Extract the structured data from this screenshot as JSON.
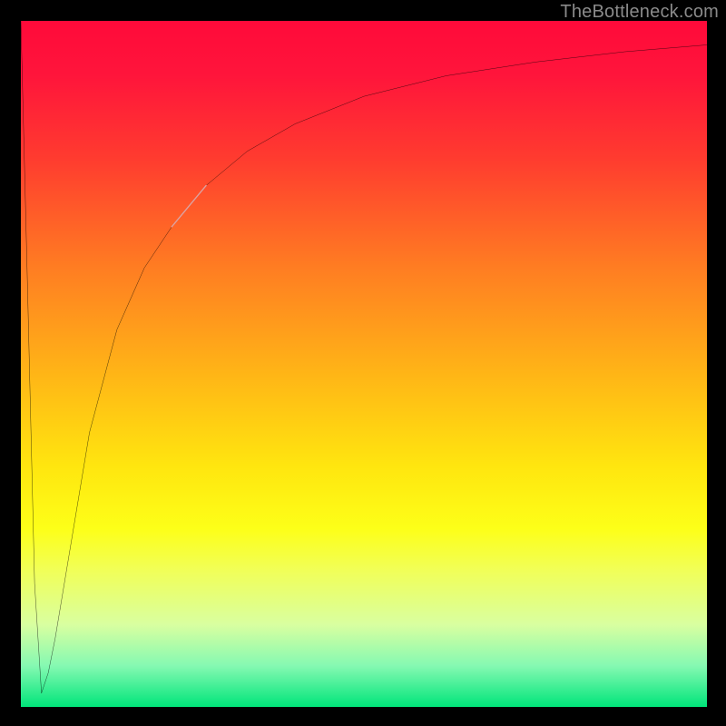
{
  "credit": "TheBottleneck.com",
  "chart_data": {
    "type": "line",
    "title": "",
    "xlabel": "",
    "ylabel": "",
    "xlim": [
      0,
      100
    ],
    "ylim": [
      0,
      100
    ],
    "grid": false,
    "series": [
      {
        "name": "curve",
        "color": "#000000",
        "x": [
          0,
          1,
          2,
          3,
          4,
          5,
          7,
          10,
          14,
          18,
          22,
          27,
          33,
          40,
          50,
          62,
          75,
          88,
          100
        ],
        "values": [
          100,
          60,
          18,
          2,
          5,
          10,
          22,
          40,
          55,
          64,
          70,
          76,
          81,
          85,
          89,
          92,
          94,
          95.5,
          96.5
        ]
      }
    ],
    "highlight_segment": {
      "color": "#dca2a1",
      "x_start": 22,
      "x_end": 27,
      "y_start": 70,
      "y_end": 76
    }
  }
}
